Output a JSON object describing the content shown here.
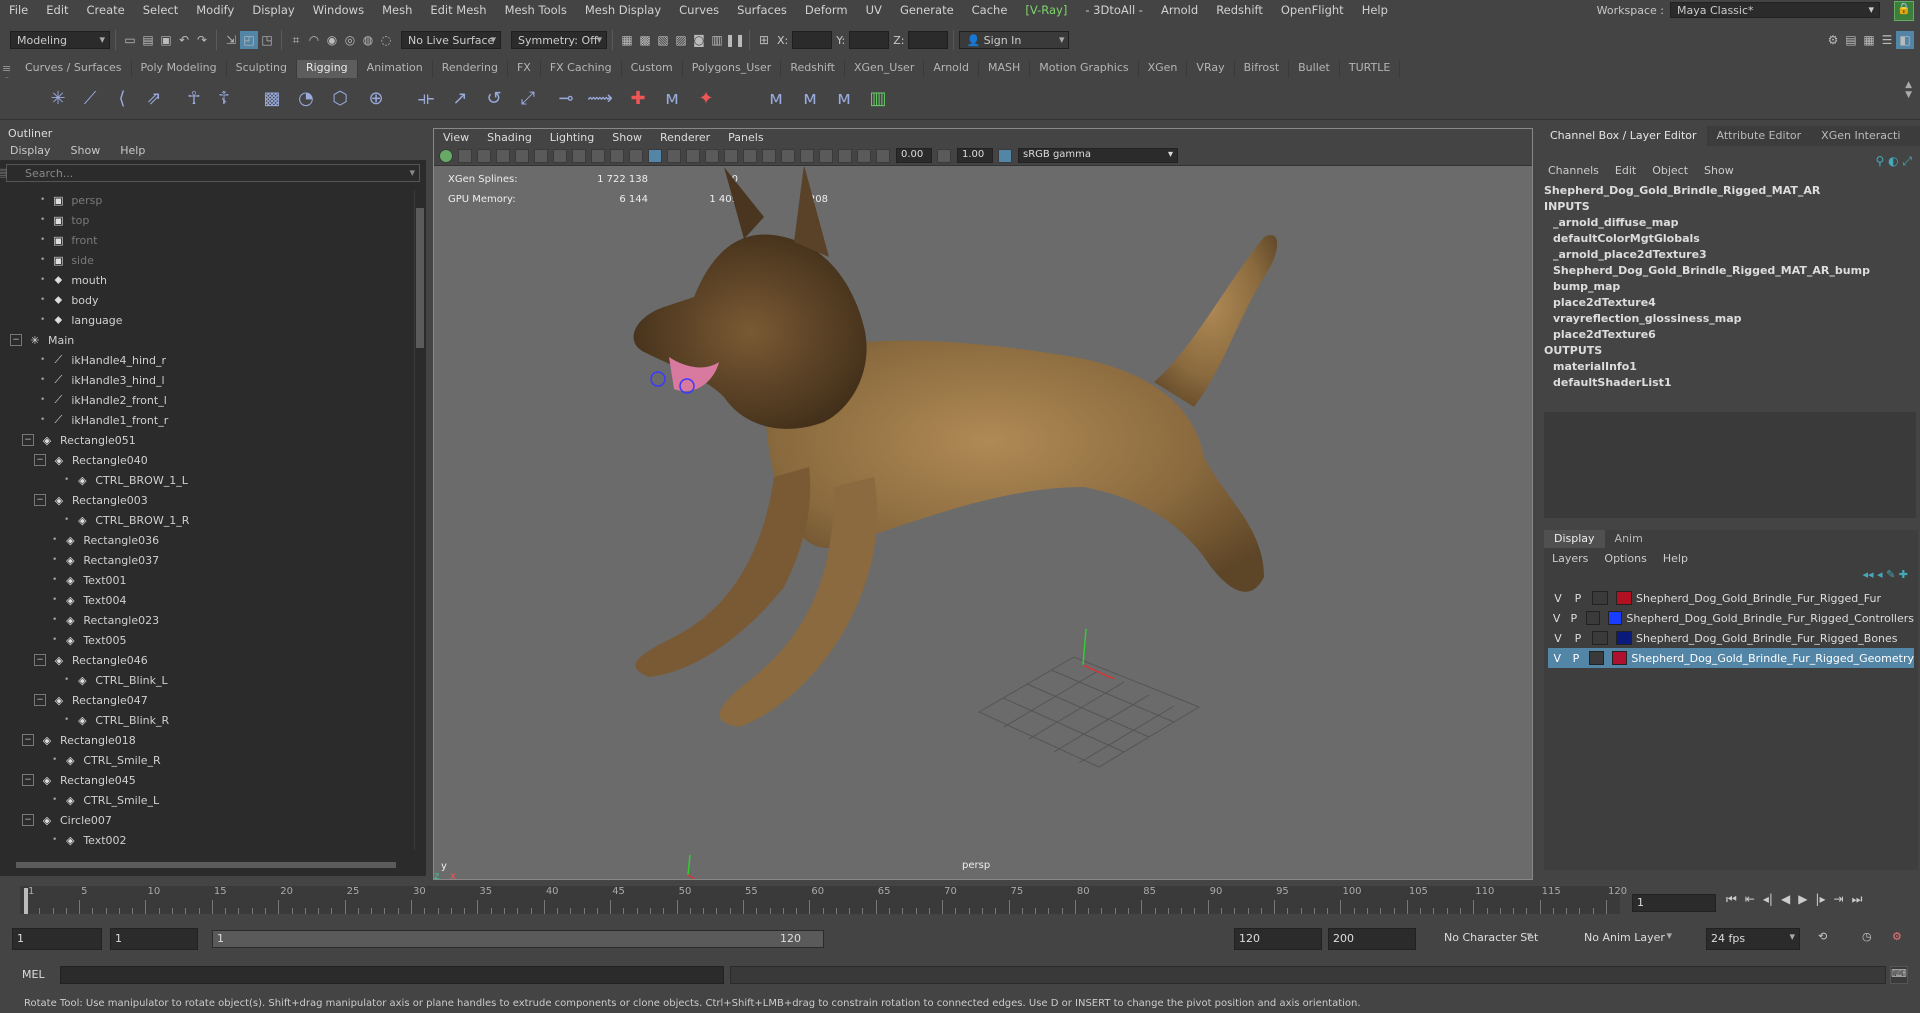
{
  "menubar": {
    "items": [
      "File",
      "Edit",
      "Create",
      "Select",
      "Modify",
      "Display",
      "Windows",
      "Mesh",
      "Edit Mesh",
      "Mesh Tools",
      "Mesh Display",
      "Curves",
      "Surfaces",
      "Deform",
      "UV",
      "Generate",
      "Cache"
    ],
    "vray": "V-Ray",
    "items2": [
      "3DtoAll",
      "Arnold",
      "Redshift",
      "OpenFlight",
      "Help"
    ],
    "workspace_label": "Workspace :",
    "workspace_value": "Maya Classic*"
  },
  "statusline": {
    "mode": "Modeling",
    "live_surface": "No Live Surface",
    "symmetry": "Symmetry: Off",
    "x_label": "X:",
    "y_label": "Y:",
    "z_label": "Z:",
    "sign_in": "Sign In"
  },
  "shelf": {
    "tabs": [
      "Curves / Surfaces",
      "Poly Modeling",
      "Sculpting",
      "Rigging",
      "Animation",
      "Rendering",
      "FX",
      "FX Caching",
      "Custom",
      "Polygons_User",
      "Redshift",
      "XGen_User",
      "Arnold",
      "MASH",
      "Motion Graphics",
      "XGen",
      "VRay",
      "Bifrost",
      "Bullet",
      "TURTLE"
    ],
    "active": "Rigging"
  },
  "outliner": {
    "title": "Outliner",
    "menus": [
      "Display",
      "Show",
      "Help"
    ],
    "search_placeholder": "Search...",
    "items": [
      {
        "label": "persp",
        "level": 1,
        "type": "cam"
      },
      {
        "label": "top",
        "level": 1,
        "type": "cam"
      },
      {
        "label": "front",
        "level": 1,
        "type": "cam"
      },
      {
        "label": "side",
        "level": 1,
        "type": "cam"
      },
      {
        "label": "mouth",
        "level": 1,
        "type": "set"
      },
      {
        "label": "body",
        "level": 1,
        "type": "set"
      },
      {
        "label": "language",
        "level": 1,
        "type": "set"
      },
      {
        "label": "Main",
        "level": 0,
        "type": "joint",
        "exp": "−"
      },
      {
        "label": "ikHandle4_hind_r",
        "level": 1,
        "type": "ik"
      },
      {
        "label": "ikHandle3_hind_l",
        "level": 1,
        "type": "ik"
      },
      {
        "label": "ikHandle2_front_l",
        "level": 1,
        "type": "ik"
      },
      {
        "label": "ikHandle1_front_r",
        "level": 1,
        "type": "ik"
      },
      {
        "label": "Rectangle051",
        "level": 1,
        "type": "curve",
        "exp": "−"
      },
      {
        "label": "Rectangle040",
        "level": 2,
        "type": "curve",
        "exp": "−"
      },
      {
        "label": "CTRL_BROW_1_L",
        "level": 3,
        "type": "curve"
      },
      {
        "label": "Rectangle003",
        "level": 2,
        "type": "curve",
        "exp": "−"
      },
      {
        "label": "CTRL_BROW_1_R",
        "level": 3,
        "type": "curve"
      },
      {
        "label": "Rectangle036",
        "level": 2,
        "type": "curve"
      },
      {
        "label": "Rectangle037",
        "level": 2,
        "type": "curve"
      },
      {
        "label": "Text001",
        "level": 2,
        "type": "curve"
      },
      {
        "label": "Text004",
        "level": 2,
        "type": "curve"
      },
      {
        "label": "Rectangle023",
        "level": 2,
        "type": "curve"
      },
      {
        "label": "Text005",
        "level": 2,
        "type": "curve"
      },
      {
        "label": "Rectangle046",
        "level": 2,
        "type": "curve",
        "exp": "−"
      },
      {
        "label": "CTRL_Blink_L",
        "level": 3,
        "type": "curve"
      },
      {
        "label": "Rectangle047",
        "level": 2,
        "type": "curve",
        "exp": "−"
      },
      {
        "label": "CTRL_Blink_R",
        "level": 3,
        "type": "curve"
      },
      {
        "label": "Rectangle018",
        "level": 1,
        "type": "curve",
        "exp": "−"
      },
      {
        "label": "CTRL_Smile_R",
        "level": 2,
        "type": "curve"
      },
      {
        "label": "Rectangle045",
        "level": 1,
        "type": "curve",
        "exp": "−"
      },
      {
        "label": "CTRL_Smile_L",
        "level": 2,
        "type": "curve"
      },
      {
        "label": "Circle007",
        "level": 1,
        "type": "curve",
        "exp": "−"
      },
      {
        "label": "Text002",
        "level": 2,
        "type": "curve"
      }
    ]
  },
  "viewport": {
    "menus": [
      "View",
      "Shading",
      "Lighting",
      "Show",
      "Renderer",
      "Panels"
    ],
    "exposure": "0.00",
    "gamma": "1.00",
    "colorspace": "sRGB gamma",
    "hud": [
      {
        "k": "XGen Splines:",
        "v1": "1 722 138",
        "v2": "0",
        "v3": ""
      },
      {
        "k": "GPU Memory:",
        "v1": "6 144",
        "v2": "1 409",
        "v3": "3 208"
      }
    ],
    "camera": "persp",
    "axis_y": "y",
    "axis_z": "z",
    "axis_x": "x"
  },
  "channelbox": {
    "tabs": [
      "Channel Box / Layer Editor",
      "Attribute Editor",
      "XGen Interacti"
    ],
    "menus": [
      "Channels",
      "Edit",
      "Object",
      "Show"
    ],
    "object": "Shepherd_Dog_Gold_Brindle_Rigged_MAT_AR",
    "inputs_label": "INPUTS",
    "inputs": [
      "_arnold_diffuse_map",
      "defaultColorMgtGlobals",
      "_arnold_place2dTexture3",
      "Shepherd_Dog_Gold_Brindle_Rigged_MAT_AR_bump",
      "bump_map",
      "place2dTexture4",
      "vrayreflection_glossiness_map",
      "place2dTexture6"
    ],
    "outputs_label": "OUTPUTS",
    "outputs": [
      "materialInfo1",
      "defaultShaderList1"
    ]
  },
  "layers": {
    "tabs": [
      "Display",
      "Anim"
    ],
    "menus": [
      "Layers",
      "Options",
      "Help"
    ],
    "rows": [
      {
        "v": "V",
        "p": "P",
        "color": "#b01020",
        "name": "Shepherd_Dog_Gold_Brindle_Fur_Rigged_Fur",
        "selected": false
      },
      {
        "v": "V",
        "p": "P",
        "color": "#1a3cff",
        "name": "Shepherd_Dog_Gold_Brindle_Fur_Rigged_Controllers",
        "selected": false
      },
      {
        "v": "V",
        "p": "P",
        "color": "#0a1a7a",
        "name": "Shepherd_Dog_Gold_Brindle_Fur_Rigged_Bones",
        "selected": false
      },
      {
        "v": "V",
        "p": "P",
        "color": "#b01030",
        "name": "Shepherd_Dog_Gold_Brindle_Fur_Rigged_Geometry",
        "selected": true
      }
    ]
  },
  "timeline": {
    "ticks": [
      "1",
      "5",
      "10",
      "15",
      "20",
      "25",
      "30",
      "35",
      "40",
      "45",
      "50",
      "55",
      "60",
      "65",
      "70",
      "75",
      "80",
      "85",
      "90",
      "95",
      "100",
      "105",
      "110",
      "115",
      "120"
    ],
    "current_frame": "1"
  },
  "range": {
    "start": "1",
    "playback_start": "1",
    "slider_start": "1",
    "slider_end": "120",
    "playback_end": "120",
    "end": "200",
    "character_set": "No Character Set",
    "anim_layer": "No Anim Layer",
    "fps": "24 fps"
  },
  "cmdline": {
    "label": "MEL"
  },
  "helpline": {
    "text": "Rotate Tool: Use manipulator to rotate object(s). Shift+drag manipulator axis or plane handles to extrude components or clone objects. Ctrl+Shift+LMB+drag to constrain rotation to connected edges. Use D or INSERT to change the pivot position and axis orientation."
  }
}
